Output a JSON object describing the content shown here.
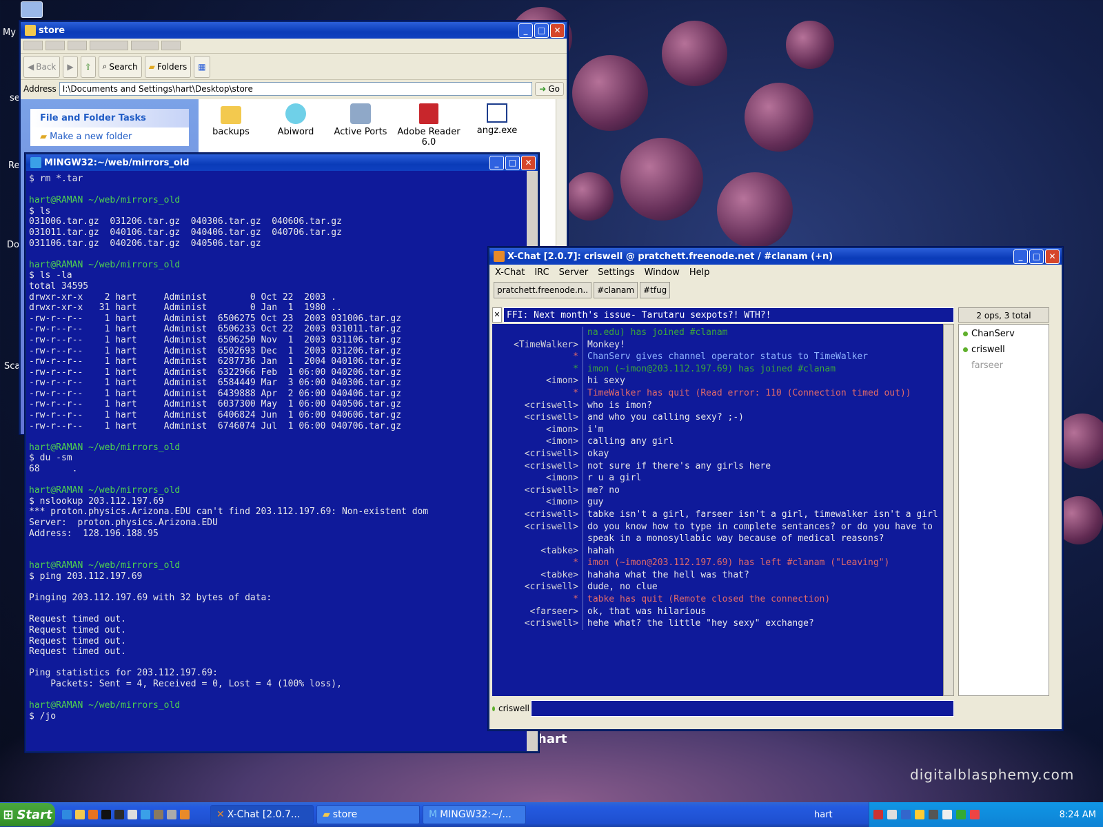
{
  "desktop": {
    "labels": [
      "My",
      "se",
      "Re",
      "Do",
      "Sca"
    ],
    "watermark": "digitalblasphemy.com",
    "hart_label": "hart"
  },
  "explorer": {
    "title": "store",
    "tool": {
      "back": "Back",
      "search": "Search",
      "folders": "Folders"
    },
    "address_label": "Address",
    "address_value": "I:\\Documents and Settings\\hart\\Desktop\\store",
    "go_label": "Go",
    "tasks_title": "File and Folder Tasks",
    "task_new_folder": "Make a new folder",
    "files": [
      {
        "name": "backups",
        "icon": "folder-icon"
      },
      {
        "name": "Abiword",
        "icon": "abiword-icon"
      },
      {
        "name": "Active Ports",
        "icon": "active-ports-icon"
      },
      {
        "name": "Adobe Reader 6.0",
        "icon": "adobe-reader-icon"
      },
      {
        "name": "angz.exe",
        "icon": "exe-icon"
      }
    ]
  },
  "terminal": {
    "title": "MINGW32:~/web/mirrors_old",
    "lines": [
      {
        "t": "$ rm *.tar",
        "c": ""
      },
      {
        "t": "",
        "c": ""
      },
      {
        "t": "hart@RAMAN ~/web/mirrors_old",
        "c": "g"
      },
      {
        "t": "$ ls",
        "c": ""
      },
      {
        "t": "031006.tar.gz  031206.tar.gz  040306.tar.gz  040606.tar.gz",
        "c": ""
      },
      {
        "t": "031011.tar.gz  040106.tar.gz  040406.tar.gz  040706.tar.gz",
        "c": ""
      },
      {
        "t": "031106.tar.gz  040206.tar.gz  040506.tar.gz",
        "c": ""
      },
      {
        "t": "",
        "c": ""
      },
      {
        "t": "hart@RAMAN ~/web/mirrors_old",
        "c": "g"
      },
      {
        "t": "$ ls -la",
        "c": ""
      },
      {
        "t": "total 34595",
        "c": ""
      },
      {
        "t": "drwxr-xr-x    2 hart     Administ        0 Oct 22  2003 .",
        "c": ""
      },
      {
        "t": "drwxr-xr-x   31 hart     Administ        0 Jan  1  1980 ..",
        "c": ""
      },
      {
        "t": "-rw-r--r--    1 hart     Administ  6506275 Oct 23  2003 031006.tar.gz",
        "c": ""
      },
      {
        "t": "-rw-r--r--    1 hart     Administ  6506233 Oct 22  2003 031011.tar.gz",
        "c": ""
      },
      {
        "t": "-rw-r--r--    1 hart     Administ  6506250 Nov  1  2003 031106.tar.gz",
        "c": ""
      },
      {
        "t": "-rw-r--r--    1 hart     Administ  6502693 Dec  1  2003 031206.tar.gz",
        "c": ""
      },
      {
        "t": "-rw-r--r--    1 hart     Administ  6287736 Jan  1  2004 040106.tar.gz",
        "c": ""
      },
      {
        "t": "-rw-r--r--    1 hart     Administ  6322966 Feb  1 06:00 040206.tar.gz",
        "c": ""
      },
      {
        "t": "-rw-r--r--    1 hart     Administ  6584449 Mar  3 06:00 040306.tar.gz",
        "c": ""
      },
      {
        "t": "-rw-r--r--    1 hart     Administ  6439888 Apr  2 06:00 040406.tar.gz",
        "c": ""
      },
      {
        "t": "-rw-r--r--    1 hart     Administ  6037300 May  1 06:00 040506.tar.gz",
        "c": ""
      },
      {
        "t": "-rw-r--r--    1 hart     Administ  6406824 Jun  1 06:00 040606.tar.gz",
        "c": ""
      },
      {
        "t": "-rw-r--r--    1 hart     Administ  6746074 Jul  1 06:00 040706.tar.gz",
        "c": ""
      },
      {
        "t": "",
        "c": ""
      },
      {
        "t": "hart@RAMAN ~/web/mirrors_old",
        "c": "g"
      },
      {
        "t": "$ du -sm",
        "c": ""
      },
      {
        "t": "68      .",
        "c": ""
      },
      {
        "t": "",
        "c": ""
      },
      {
        "t": "hart@RAMAN ~/web/mirrors_old",
        "c": "g"
      },
      {
        "t": "$ nslookup 203.112.197.69",
        "c": ""
      },
      {
        "t": "*** proton.physics.Arizona.EDU can't find 203.112.197.69: Non-existent dom",
        "c": ""
      },
      {
        "t": "Server:  proton.physics.Arizona.EDU",
        "c": ""
      },
      {
        "t": "Address:  128.196.188.95",
        "c": ""
      },
      {
        "t": "",
        "c": ""
      },
      {
        "t": "",
        "c": ""
      },
      {
        "t": "hart@RAMAN ~/web/mirrors_old",
        "c": "g"
      },
      {
        "t": "$ ping 203.112.197.69",
        "c": ""
      },
      {
        "t": "",
        "c": ""
      },
      {
        "t": "Pinging 203.112.197.69 with 32 bytes of data:",
        "c": ""
      },
      {
        "t": "",
        "c": ""
      },
      {
        "t": "Request timed out.",
        "c": ""
      },
      {
        "t": "Request timed out.",
        "c": ""
      },
      {
        "t": "Request timed out.",
        "c": ""
      },
      {
        "t": "Request timed out.",
        "c": ""
      },
      {
        "t": "",
        "c": ""
      },
      {
        "t": "Ping statistics for 203.112.197.69:",
        "c": ""
      },
      {
        "t": "    Packets: Sent = 4, Received = 0, Lost = 4 (100% loss),",
        "c": ""
      },
      {
        "t": "",
        "c": ""
      },
      {
        "t": "hart@RAMAN ~/web/mirrors_old",
        "c": "g"
      },
      {
        "t": "$ /jo",
        "c": ""
      }
    ]
  },
  "xchat": {
    "title": "X-Chat [2.0.7]: criswell @ pratchett.freenode.net / #clanam (+n)",
    "menu": [
      "X-Chat",
      "IRC",
      "Server",
      "Settings",
      "Window",
      "Help"
    ],
    "tabs": [
      "pratchett.freenode.n..",
      "#clanam",
      "#tfug"
    ],
    "topic": "FFI: Next month's issue- Tarutaru sexpots?! WTH?!",
    "user_count": "2 ops, 3 total",
    "users": [
      {
        "name": "ChanServ",
        "op": true
      },
      {
        "name": "criswell",
        "op": true
      },
      {
        "name": "farseer",
        "op": false
      }
    ],
    "messages": [
      {
        "nick": "",
        "text": "na.edu) has joined #clanam",
        "kind": "join"
      },
      {
        "nick": "<TimeWalker>",
        "text": "Monkey!",
        "kind": ""
      },
      {
        "nick": "*",
        "text": "ChanServ gives channel operator status to TimeWalker",
        "kind": "sys"
      },
      {
        "nick": "*",
        "text": "imon (~imon@203.112.197.69) has joined #clanam",
        "kind": "join"
      },
      {
        "nick": "<imon>",
        "text": "hi sexy",
        "kind": ""
      },
      {
        "nick": "*",
        "text": "TimeWalker has quit (Read error: 110 (Connection timed out))",
        "kind": "quit"
      },
      {
        "nick": "<criswell>",
        "text": "who is imon?",
        "kind": ""
      },
      {
        "nick": "<criswell>",
        "text": "and who you calling sexy? ;-)",
        "kind": ""
      },
      {
        "nick": "<imon>",
        "text": "i'm",
        "kind": ""
      },
      {
        "nick": "<imon>",
        "text": "calling any girl",
        "kind": ""
      },
      {
        "nick": "<criswell>",
        "text": "okay",
        "kind": ""
      },
      {
        "nick": "<criswell>",
        "text": "not sure if there's any girls here",
        "kind": ""
      },
      {
        "nick": "<imon>",
        "text": "r u a girl",
        "kind": ""
      },
      {
        "nick": "<criswell>",
        "text": "me? no",
        "kind": ""
      },
      {
        "nick": "<imon>",
        "text": "guy",
        "kind": ""
      },
      {
        "nick": "<criswell>",
        "text": "tabke isn't a girl, farseer isn't a girl, timewalker isn't a girl",
        "kind": ""
      },
      {
        "nick": "<criswell>",
        "text": "do you know how to type in complete sentances? or do you have to speak in a monosyllabic way because of medical reasons?",
        "kind": ""
      },
      {
        "nick": "<tabke>",
        "text": "hahah",
        "kind": ""
      },
      {
        "nick": "*",
        "text": "imon (~imon@203.112.197.69) has left #clanam (\"Leaving\")",
        "kind": "quit"
      },
      {
        "nick": "<tabke>",
        "text": "hahaha what the hell was that?",
        "kind": ""
      },
      {
        "nick": "<criswell>",
        "text": "dude, no clue",
        "kind": ""
      },
      {
        "nick": "*",
        "text": "tabke has quit (Remote closed the connection)",
        "kind": "quit"
      },
      {
        "nick": "<farseer>",
        "text": "ok, that was hilarious",
        "kind": ""
      },
      {
        "nick": "<criswell>",
        "text": "hehe what? the little \"hey sexy\" exchange?",
        "kind": ""
      }
    ],
    "input_nick": "criswell"
  },
  "taskbar": {
    "start_label": "Start",
    "tasks": [
      "X-Chat [2.0.7...",
      "store",
      "MINGW32:~/..."
    ],
    "user_label": "hart",
    "clock": "8:24 AM"
  },
  "colors": {
    "term_bg": "#0f1a9a",
    "title_blue": "#0a3bb8",
    "taskbar": "#245ae0"
  }
}
